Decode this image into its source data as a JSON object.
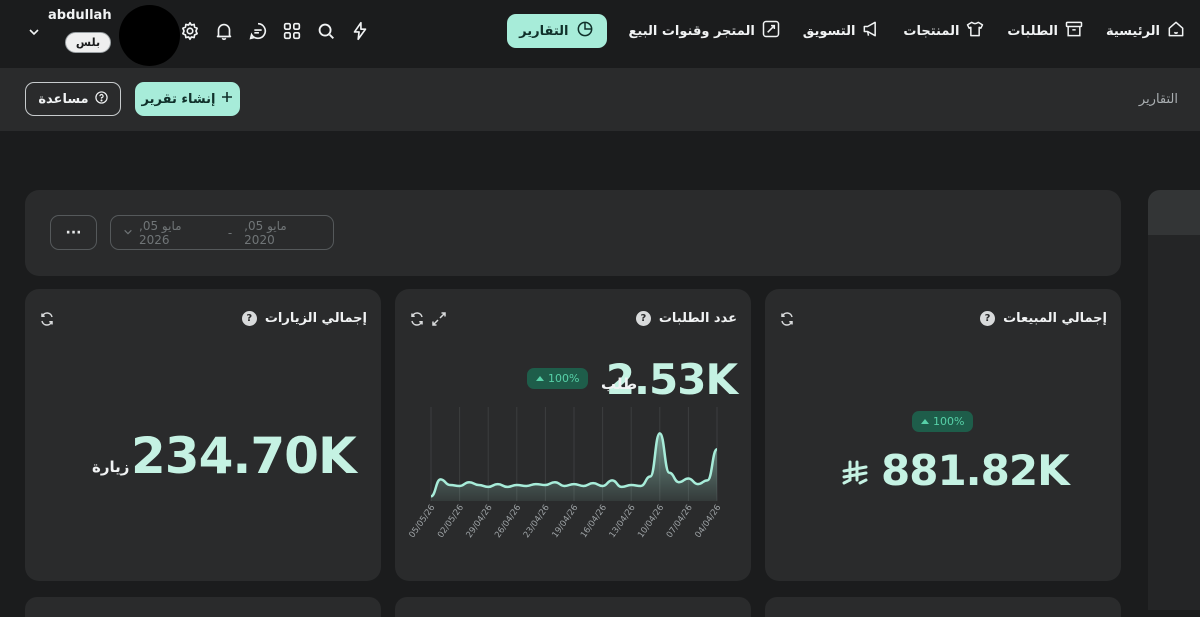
{
  "nav": {
    "items": [
      {
        "label": "الرئيسية",
        "icon": "home-icon"
      },
      {
        "label": "الطلبات",
        "icon": "archive-icon"
      },
      {
        "label": "المنتجات",
        "icon": "shirt-icon"
      },
      {
        "label": "التسويق",
        "icon": "megaphone-icon"
      },
      {
        "label": "المتجر وقنوات البيع",
        "icon": "storefront-icon"
      },
      {
        "label": "التقارير",
        "icon": "pie-chart-icon",
        "active": true
      }
    ]
  },
  "account": {
    "username": "abdullah",
    "plan": "بلس"
  },
  "toolbar": {
    "breadcrumb": "التقارير",
    "help_label": "مساعدة",
    "create_report_label": "إنشاء تقرير"
  },
  "filters": {
    "more_label": "···",
    "date_from": "مايو 05, 2020",
    "date_to": "مايو 05, 2026",
    "date_separator": "-"
  },
  "cards": {
    "sales": {
      "title": "إجمالي المبيعات",
      "value": "881.82K",
      "change": "100%",
      "currency_symbol": "⃁"
    },
    "orders": {
      "title": "عدد الطلبات",
      "value": "2.53K",
      "unit": "طلب",
      "change": "100%"
    },
    "visits": {
      "title": "إجمالي الزيارات",
      "value": "234.70K",
      "unit": "زيارة"
    }
  },
  "chart_data": {
    "type": "area",
    "title": "",
    "x": [
      "05/05/26",
      "02/05/26",
      "29/04/26",
      "26/04/26",
      "23/04/26",
      "19/04/26",
      "16/04/26",
      "13/04/26",
      "10/04/26",
      "07/04/26",
      "04/04/26"
    ],
    "series": [
      {
        "values": [
          5,
          23,
          17,
          16,
          20,
          17,
          15,
          18,
          15,
          17,
          16,
          18,
          17,
          20,
          16,
          18,
          16,
          19,
          16,
          22,
          15,
          17,
          16,
          26,
          72,
          30,
          20,
          24,
          18,
          22,
          55
        ],
        "color": "#a7ecd9"
      }
    ],
    "grid": true,
    "ylim": [
      0,
      100
    ],
    "colors": {
      "line": "#a7ecd9",
      "fill": "#a7ecd9"
    }
  },
  "colors": {
    "accent": "#a7ecd9",
    "positive_badge_bg": "#1e5d4a",
    "positive_badge_text": "#57d1a8",
    "card_bg": "#2a2b2c",
    "page_bg": "#1b1c1d"
  }
}
